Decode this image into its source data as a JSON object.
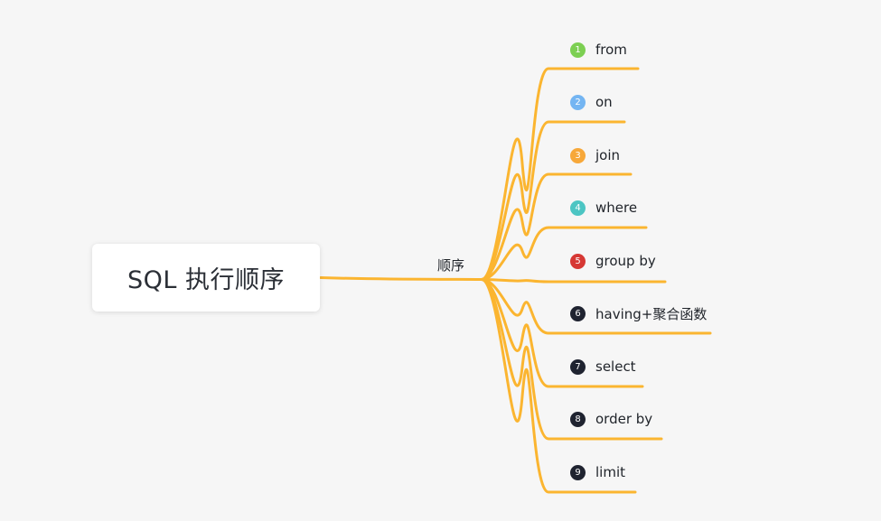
{
  "root": {
    "title": "SQL 执行顺序"
  },
  "branch": {
    "label": "顺序"
  },
  "connector_color": "#fbb530",
  "steps": [
    {
      "number": "1",
      "label": "from",
      "badge_color": "#7ccf52"
    },
    {
      "number": "2",
      "label": "on",
      "badge_color": "#74b5f2"
    },
    {
      "number": "3",
      "label": "join",
      "badge_color": "#f7a83a"
    },
    {
      "number": "4",
      "label": "where",
      "badge_color": "#4cc5c3"
    },
    {
      "number": "5",
      "label": "group by",
      "badge_color": "#d63834"
    },
    {
      "number": "6",
      "label": "having+聚合函数",
      "badge_color": "#1f2330"
    },
    {
      "number": "7",
      "label": "select",
      "badge_color": "#1f2330"
    },
    {
      "number": "8",
      "label": "order by",
      "badge_color": "#1f2330"
    },
    {
      "number": "9",
      "label": "limit",
      "badge_color": "#1f2330"
    }
  ]
}
